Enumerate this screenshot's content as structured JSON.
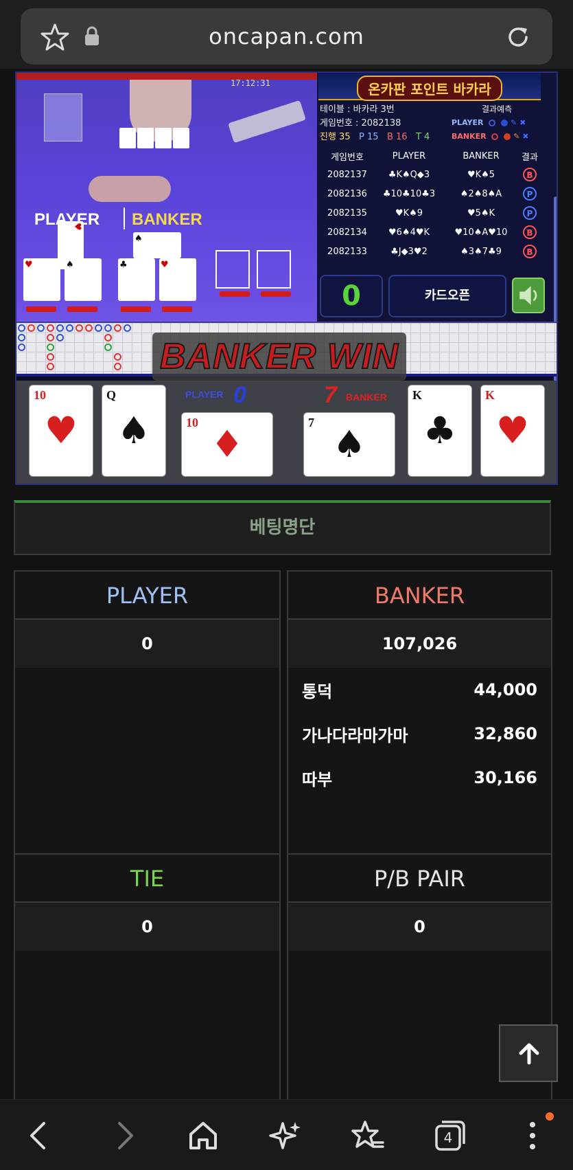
{
  "browser": {
    "url": "oncapan.com"
  },
  "video": {
    "timer": "17:12:31",
    "player_label": "PLAYER",
    "banker_label": "BANKER"
  },
  "info": {
    "banner": "온카판 포인트 바카라",
    "table_label": "테이블 : 바카라 3번",
    "game_no_label": "게임번호 : 2082138",
    "result_predict": "결과예측",
    "progress": "진행 35",
    "p_count": "P 15",
    "b_count": "B 16",
    "t_count": "T 4",
    "predict_player": "PLAYER",
    "predict_banker": "BANKER"
  },
  "history": {
    "headers": [
      "게임번호",
      "PLAYER",
      "BANKER",
      "결과"
    ],
    "rows": [
      {
        "no": "2082137",
        "player": "♣K♠Q◆3",
        "banker": "♥K♠5",
        "result": "B"
      },
      {
        "no": "2082136",
        "player": "♣10♣10♣3",
        "banker": "♠2♠8♠A",
        "result": "P"
      },
      {
        "no": "2082135",
        "player": "♥K♠9",
        "banker": "♥5♠K",
        "result": "P"
      },
      {
        "no": "2082134",
        "player": "♥6♠4♥K",
        "banker": "♥10♠A♥10",
        "result": "B"
      },
      {
        "no": "2082133",
        "player": "♣J◆3♥2",
        "banker": "♠3♠7♣9",
        "result": "B"
      }
    ]
  },
  "controls": {
    "count": "0",
    "card_open": "카드오픈"
  },
  "result": {
    "banner": "BANKER WIN",
    "player_label": "PLAYER",
    "player_score": "0",
    "banker_label": "BANKER",
    "banker_score": "7"
  },
  "cards": {
    "player": [
      {
        "rank": "10",
        "suit": "♥",
        "color": "red"
      },
      {
        "rank": "Q",
        "suit": "♠",
        "color": "black"
      },
      {
        "rank": "10",
        "suit": "♦",
        "color": "red"
      }
    ],
    "banker": [
      {
        "rank": "7",
        "suit": "♠",
        "color": "black"
      },
      {
        "rank": "K",
        "suit": "♣",
        "color": "black"
      },
      {
        "rank": "K",
        "suit": "♥",
        "color": "red"
      }
    ]
  },
  "betting": {
    "title": "베팅명단",
    "player": {
      "label": "PLAYER",
      "total": "0"
    },
    "banker": {
      "label": "BANKER",
      "total": "107,026",
      "entries": [
        {
          "name": "통덕",
          "amount": "44,000"
        },
        {
          "name": "가나다라마가마",
          "amount": "32,860"
        },
        {
          "name": "따부",
          "amount": "30,166"
        }
      ]
    },
    "tie": {
      "label": "TIE",
      "total": "0"
    },
    "pair": {
      "label": "P/B PAIR",
      "total": "0"
    }
  },
  "nav": {
    "tab_count": "4"
  },
  "colors": {
    "player": "#9fc2f4",
    "banker": "#f07a6a",
    "tie": "#7bd64e",
    "accent_green": "#3d8a3d"
  }
}
